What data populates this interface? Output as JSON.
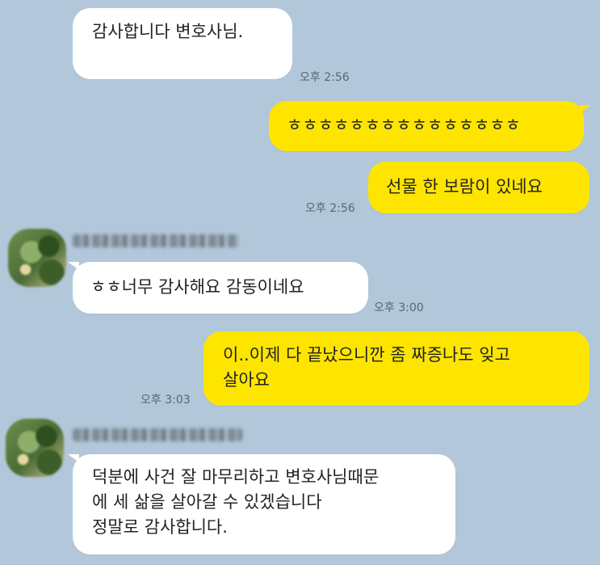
{
  "chat": {
    "messages": [
      {
        "direction": "in",
        "lines": [
          "감사합니다 변호사님."
        ],
        "time": "오후 2:56"
      },
      {
        "direction": "out",
        "lines": [
          "ㅎㅎㅎㅎㅎㅎㅎㅎㅎㅎㅎㅎㅎㅎㅎ"
        ],
        "time": ""
      },
      {
        "direction": "out",
        "lines": [
          "선물 한 보람이 있네요"
        ],
        "time": "오후 2:56"
      },
      {
        "direction": "in",
        "sender": "",
        "lines": [
          "ㅎㅎ너무 감사해요 감동이네요"
        ],
        "time": "오후 3:00"
      },
      {
        "direction": "out",
        "lines": [
          "이..이제 다 끝났으니깐 좀 짜증나도 잊고",
          "살아요"
        ],
        "time": "오후 3:03"
      },
      {
        "direction": "in",
        "sender": "",
        "lines": [
          "덕분에 사건 잘 마무리하고 변호사님때문",
          "에 세 삶을 살아갈 수 있겠습니다",
          "정말로 감사합니다."
        ],
        "time": ""
      }
    ]
  },
  "colors": {
    "background": "#b2c7d9",
    "incoming_bubble": "#ffffff",
    "outgoing_bubble": "#fee500",
    "timestamp": "#5a6671"
  }
}
